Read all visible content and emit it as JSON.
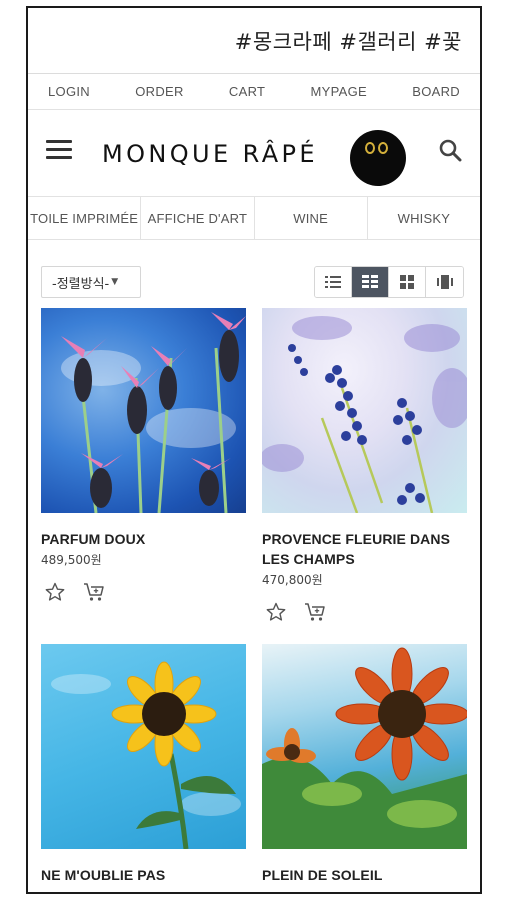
{
  "banner": {
    "hashtags": "#몽크라페 #갤러리 #꽃"
  },
  "util_nav": [
    "LOGIN",
    "ORDER",
    "CART",
    "MYPAGE",
    "BOARD"
  ],
  "header": {
    "logo": "MONQUE RÂPÉ"
  },
  "categories": [
    "TOILE IMPRIMÉE",
    "AFFICHE D'ART",
    "WINE",
    "WHISKY"
  ],
  "toolbar": {
    "sort_label": "-정렬방식-",
    "view_modes": [
      "list-view",
      "grid-2-view",
      "grid-small-view",
      "gallery-view"
    ],
    "active_view": "grid-2-view"
  },
  "products": [
    {
      "name": "PARFUM DOUX",
      "price": "489,500원",
      "art": "purple lavender flowers on blue sky"
    },
    {
      "name": "PROVENCE FLEURIE DANS LES CHAMPS",
      "price": "470,800원",
      "art": "blue lavender sprigs on pale field"
    },
    {
      "name": "NE M'OUBLIE PAS",
      "price": "",
      "art": "yellow sunflower on blue sky"
    },
    {
      "name": "PLEIN DE SOLEIL",
      "price": "",
      "art": "orange sunflowers with green leaves"
    }
  ],
  "colors": {
    "active_view_bg": "#4d5561",
    "owl_eye": "#d4b03b"
  }
}
